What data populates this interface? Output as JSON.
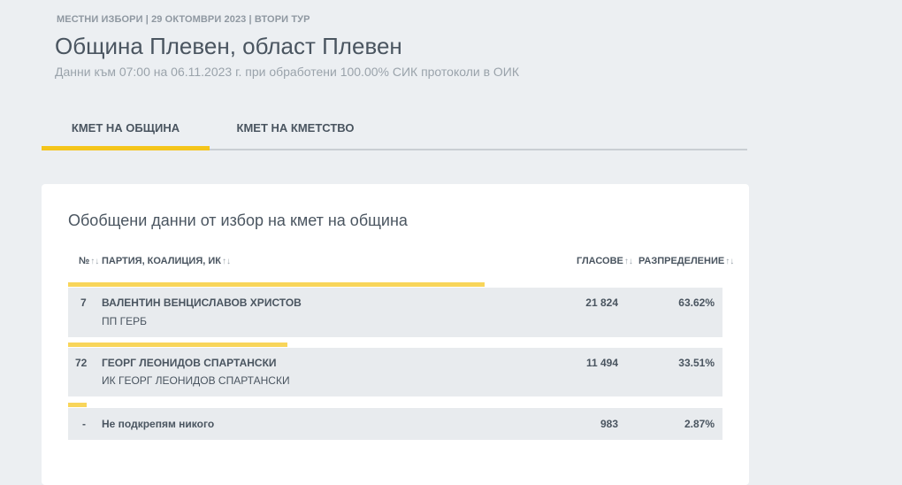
{
  "header": {
    "meta": "МЕСТНИ ИЗБОРИ | 29 ОКТОМВРИ 2023 | ВТОРИ ТУР",
    "title": "Община Плевен, област Плевен",
    "subtitle": "Данни към 07:00 на 06.11.2023 г. при обработени 100.00% СИК протоколи в ОИК"
  },
  "tabs": [
    {
      "label": "КМЕТ НА ОБЩИНА",
      "active": true
    },
    {
      "label": "КМЕТ НА КМЕТСТВО",
      "active": false
    }
  ],
  "card": {
    "title": "Обобщени данни от избор на кмет на община",
    "columns": {
      "num": "№",
      "party": "ПАРТИЯ, КОАЛИЦИЯ, ИК",
      "votes": "ГЛАСОВЕ",
      "share": "РАЗПРЕДЕЛЕНИЕ"
    },
    "rows": [
      {
        "num": "7",
        "name": "ВАЛЕНТИН ВЕНЦИСЛАВОВ ХРИСТОВ",
        "party": "ПП ГЕРБ",
        "votes": "21 824",
        "share": "63.62%",
        "share_value": 63.62
      },
      {
        "num": "72",
        "name": "ГЕОРГ ЛЕОНИДОВ СПАРТАНСКИ",
        "party": "ИК ГЕОРГ ЛЕОНИДОВ СПАРТАНСКИ",
        "votes": "11 494",
        "share": "33.51%",
        "share_value": 33.51
      },
      {
        "num": "-",
        "name": "Не подкрепям никого",
        "party": "",
        "votes": "983",
        "share": "2.87%",
        "share_value": 2.87
      }
    ]
  },
  "colors": {
    "accent": "#f4c51c",
    "bar": "#f8d55a",
    "row_bg": "#e8ebee",
    "page_bg": "#eceff2"
  },
  "icons": {
    "sort": "sort-arrows-icon"
  }
}
